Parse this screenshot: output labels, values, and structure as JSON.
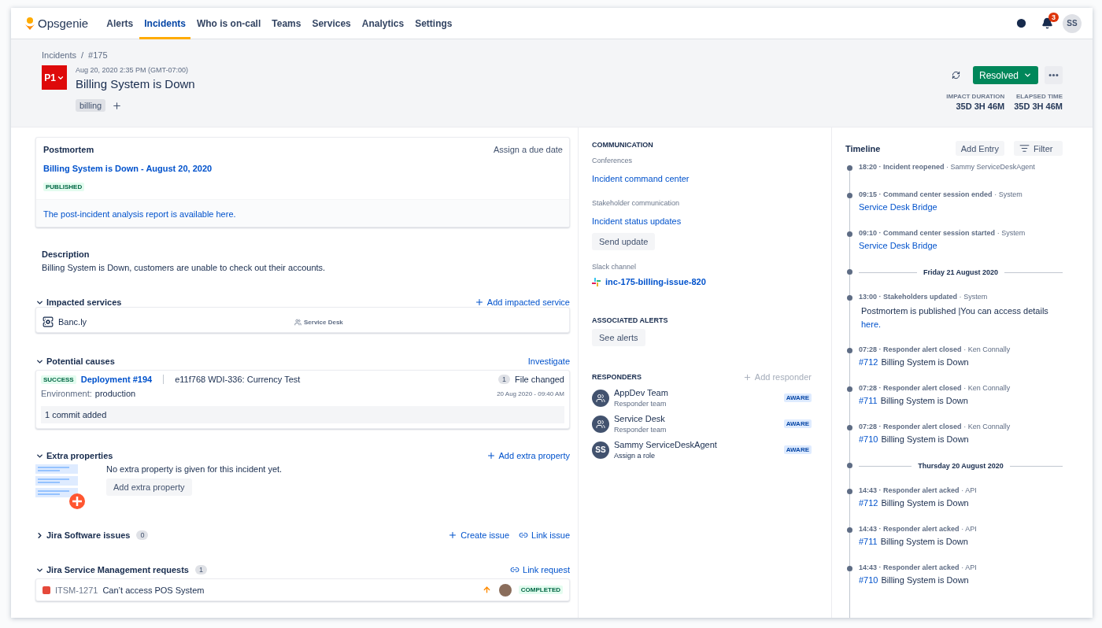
{
  "nav": {
    "logo": "Opsgenie",
    "tabs": [
      {
        "label": "Alerts",
        "selected": false
      },
      {
        "label": "Incidents",
        "selected": true
      },
      {
        "label": "Who is on-call",
        "selected": false
      },
      {
        "label": "Teams",
        "selected": false
      },
      {
        "label": "Services",
        "selected": false
      },
      {
        "label": "Analytics",
        "selected": false
      },
      {
        "label": "Settings",
        "selected": false
      }
    ],
    "notification_count": "3",
    "avatar": "SS"
  },
  "header": {
    "breadcrumb": [
      "Incidents",
      "#175"
    ],
    "breadcrumb_separator": "/",
    "priority": "P1",
    "date": "Aug 20, 2020 2:35 PM (GMT-07:00)",
    "title": "Billing System is Down",
    "tags": [
      "billing"
    ],
    "status": "Resolved",
    "stats": [
      {
        "label": "IMPACT DURATION",
        "value": "35D 3H 46M"
      },
      {
        "label": "ELAPSED TIME",
        "value": "35D 3H 46M"
      }
    ]
  },
  "postmortem": {
    "title": "Postmortem",
    "due": "Assign a due date",
    "link": "Billing System is Down - August 20, 2020",
    "badge": "PUBLISHED",
    "report": "The post-incident analysis report is available here."
  },
  "description": {
    "title": "Description",
    "text": "Billing System is Down, customers are unable to check out their accounts."
  },
  "impacted_services": {
    "title": "Impacted services",
    "expanded": true,
    "action": "Add impacted service",
    "rows": [
      {
        "name": "Banc.ly",
        "team": "Service Desk"
      }
    ]
  },
  "potential_causes": {
    "title": "Potential causes",
    "expanded": true,
    "action": "Investigate",
    "badge": "SUCCESS",
    "deployment": "Deployment #194",
    "commit": "e11f768 WDI-336: Currency Test",
    "files_count": "1",
    "files_label": "File changed",
    "environment_label": "Environment:",
    "environment": "production",
    "date": "20 Aug 2020 - 09:40 AM",
    "commits": "1 commit added"
  },
  "extra_properties": {
    "title": "Extra properties",
    "expanded": true,
    "action": "Add extra property",
    "empty_text": "No extra property is given for this incident yet.",
    "button": "Add extra property"
  },
  "jira_software": {
    "title": "Jira Software issues",
    "expanded": false,
    "count": "0",
    "actions": [
      "Create issue",
      "Link issue"
    ]
  },
  "jsm_requests": {
    "title": "Jira Service Management requests",
    "expanded": true,
    "count": "1",
    "action": "Link request",
    "rows": [
      {
        "key": "ITSM-1271",
        "summary": "Can’t access POS System",
        "status": "COMPLETED"
      }
    ]
  },
  "communication": {
    "title": "COMMUNICATION",
    "conferences_label": "Conferences",
    "conference": "Incident command center",
    "stakeholder_label": "Stakeholder communication",
    "stakeholder": "Incident status updates",
    "send_update": "Send update",
    "slack_label": "Slack channel",
    "slack": "inc-175-billing-issue-820"
  },
  "associated_alerts": {
    "title": "ASSOCIATED ALERTS",
    "button": "See alerts"
  },
  "responders": {
    "title": "RESPONDERS",
    "add": "Add responder",
    "items": [
      {
        "kind": "team",
        "name": "AppDev Team",
        "role": "Responder team",
        "status": "AWARE"
      },
      {
        "kind": "team",
        "name": "Service Desk",
        "role": "Responder team",
        "status": "AWARE"
      },
      {
        "kind": "user",
        "initials": "SS",
        "name": "Sammy ServiceDeskAgent",
        "role": "Assign a role",
        "status": "AWARE"
      }
    ]
  },
  "timeline": {
    "title": "Timeline",
    "separator": "·",
    "add": "Add Entry",
    "filter": "Filter",
    "items": [
      {
        "kind": "event",
        "time": "18:20",
        "action": "Incident reopened",
        "actor": "Sammy ServiceDeskAgent"
      },
      {
        "kind": "event",
        "time": "09:15",
        "action": "Command center session ended",
        "actor": "System",
        "link": "Service Desk Bridge"
      },
      {
        "kind": "event",
        "time": "09:10",
        "action": "Command center session started",
        "actor": "System",
        "link": "Service Desk Bridge"
      },
      {
        "kind": "date",
        "label": "Friday 21 August 2020"
      },
      {
        "kind": "event",
        "time": "13:00",
        "action": "Stakeholders updated",
        "actor": "System",
        "note": "Postmortem is published |You can access details",
        "note_link": "here."
      },
      {
        "kind": "event",
        "time": "07:28",
        "action": "Responder alert closed",
        "actor": "Ken Connally",
        "ref": "#712",
        "text": "Billing System is Down"
      },
      {
        "kind": "event",
        "time": "07:28",
        "action": "Responder alert closed",
        "actor": "Ken Connally",
        "ref": "#711",
        "text": "Billing System is Down"
      },
      {
        "kind": "event",
        "time": "07:28",
        "action": "Responder alert closed",
        "actor": "Ken Connally",
        "ref": "#710",
        "text": "Billing System is Down"
      },
      {
        "kind": "date",
        "label": "Thursday 20 August 2020"
      },
      {
        "kind": "event",
        "time": "14:43",
        "action": "Responder alert acked",
        "actor": "API",
        "ref": "#712",
        "text": "Billing System is Down"
      },
      {
        "kind": "event",
        "time": "14:43",
        "action": "Responder alert acked",
        "actor": "API",
        "ref": "#711",
        "text": "Billing System is Down"
      },
      {
        "kind": "event",
        "time": "14:43",
        "action": "Responder alert acked",
        "actor": "API",
        "ref": "#710",
        "text": "Billing System is Down"
      }
    ]
  }
}
